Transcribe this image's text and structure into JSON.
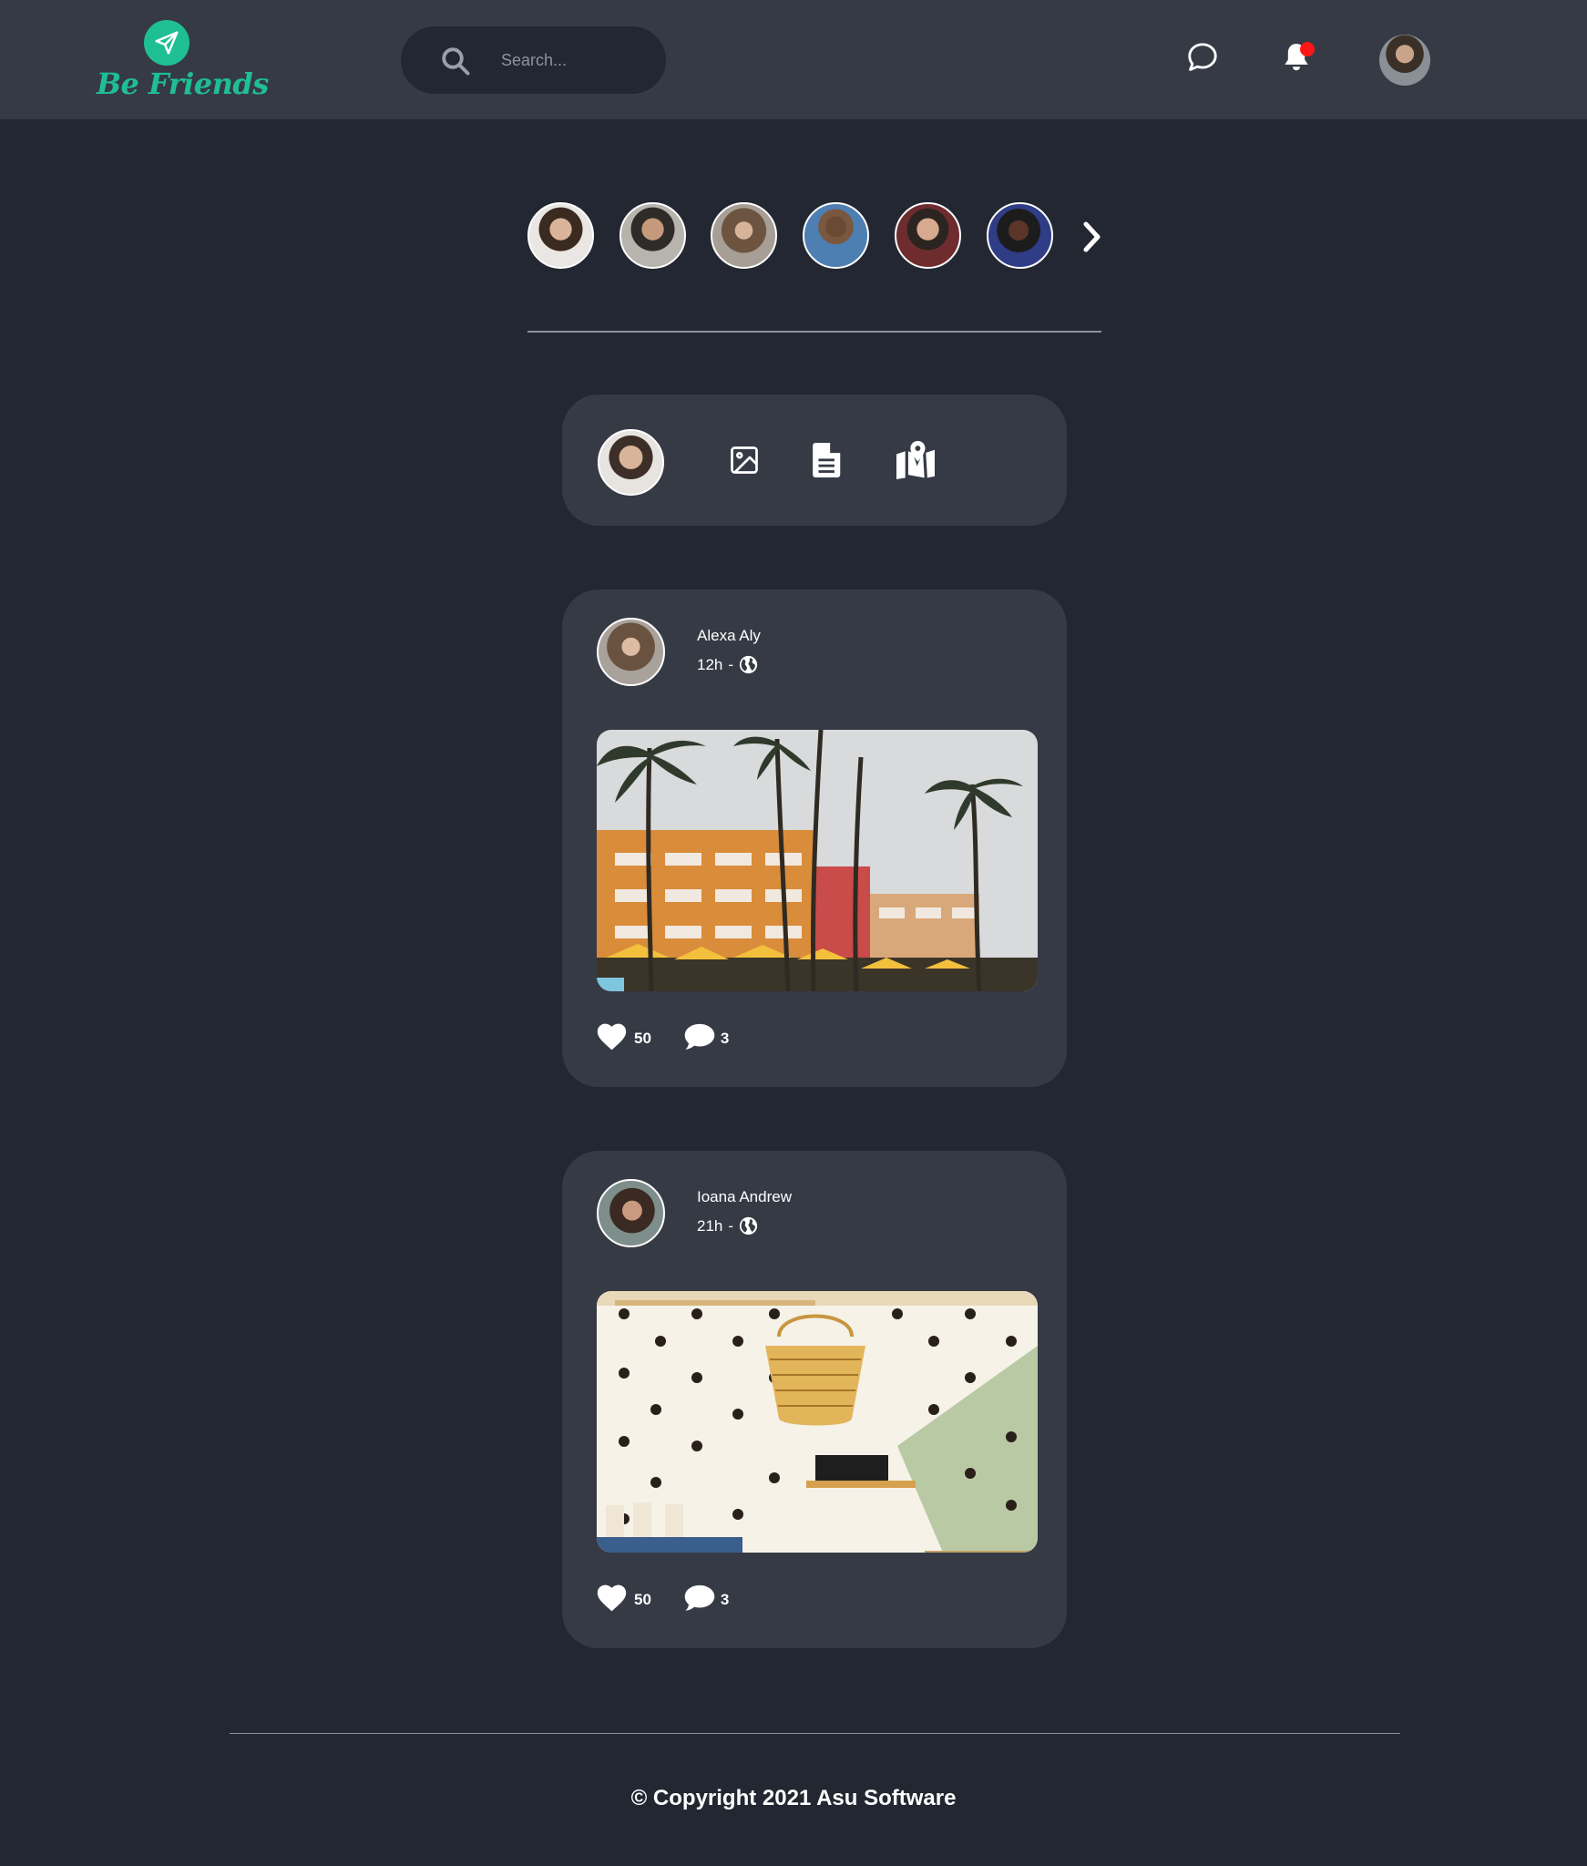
{
  "brand": {
    "name": "Be Friends",
    "accent": "#1fbf94"
  },
  "header": {
    "search": {
      "placeholder": "Search...",
      "value": ""
    },
    "icons": [
      "search-icon",
      "chat-icon",
      "bell-icon"
    ],
    "notification_badge_color": "#ff1717"
  },
  "stories": {
    "count": 6,
    "next_icon": "chevron-right-icon"
  },
  "composer": {
    "actions": [
      "image-icon",
      "document-icon",
      "map-marker-icon"
    ]
  },
  "posts": [
    {
      "author": "Alexa Aly",
      "time": "12h",
      "separator": "-",
      "visibility_icon": "globe-icon",
      "likes": "50",
      "comments": "3"
    },
    {
      "author": "Ioana Andrew",
      "time": "21h",
      "separator": "-",
      "visibility_icon": "globe-icon",
      "likes": "50",
      "comments": "3"
    }
  ],
  "footer": {
    "copyright": "© Copyright 2021 Asu Software"
  },
  "colors": {
    "background": "#222732",
    "surface": "#363a45",
    "text": "#ffffff"
  }
}
